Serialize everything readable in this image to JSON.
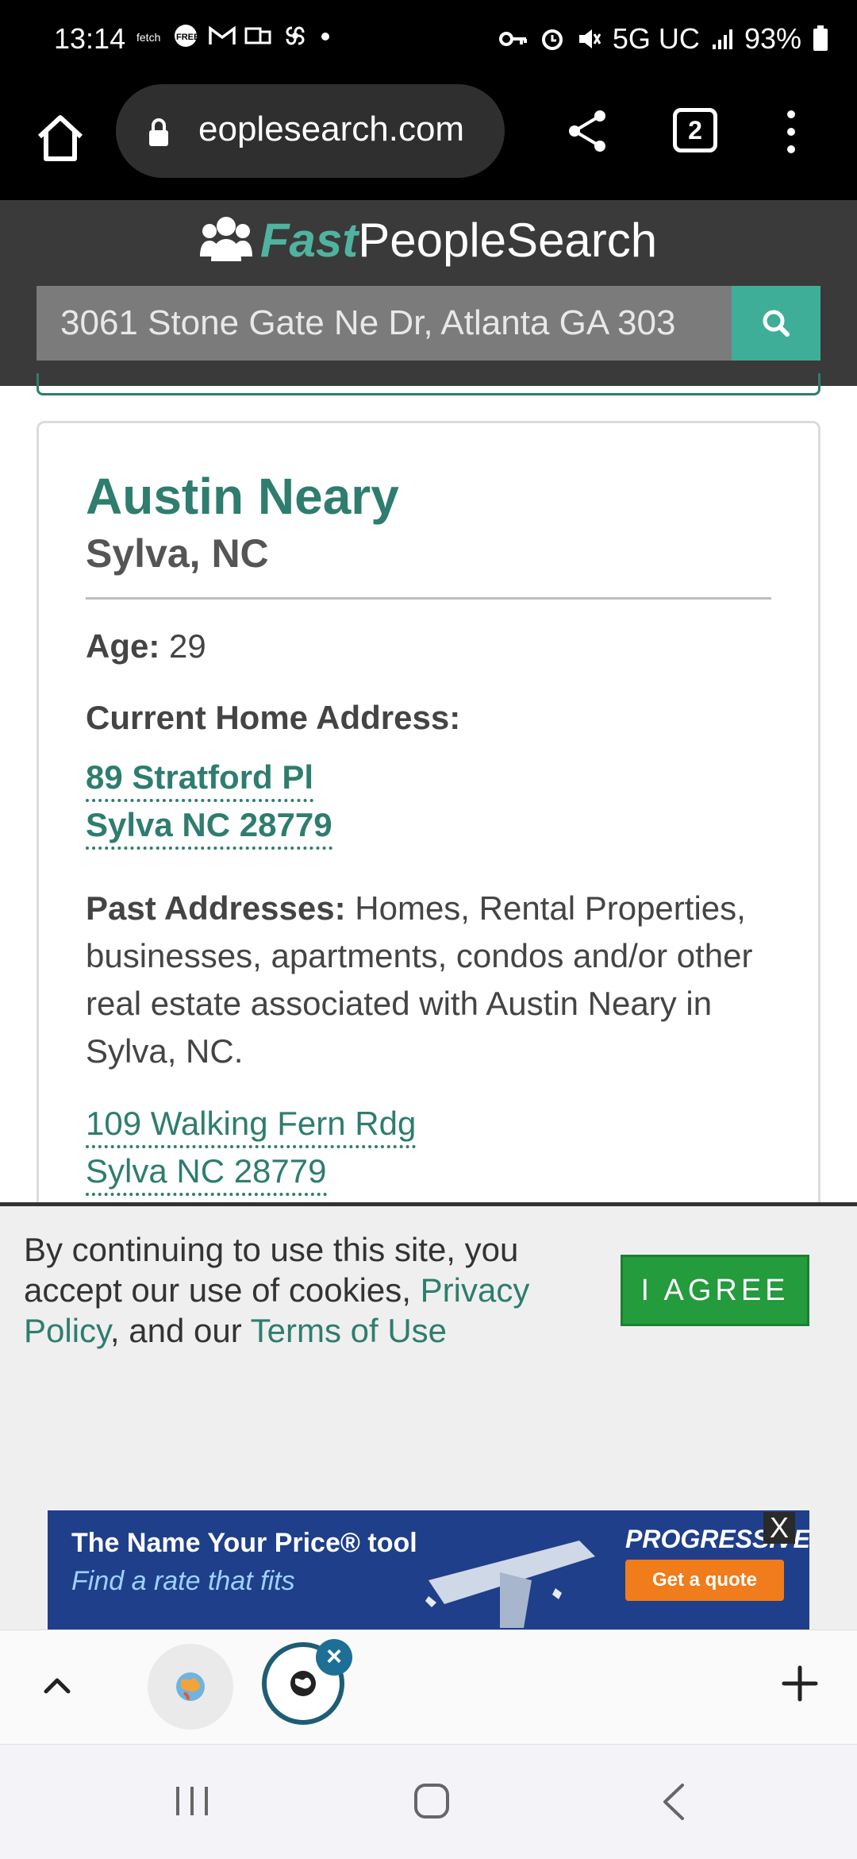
{
  "status_bar": {
    "time": "13:14",
    "network": "5G UC",
    "battery": "93%"
  },
  "browser": {
    "url": "eoplesearch.com",
    "tab_count": "2"
  },
  "site": {
    "logo_fast": "Fast",
    "logo_rest": "PeopleSearch",
    "search_value": "3061 Stone Gate Ne Dr, Atlanta GA 303"
  },
  "person": {
    "name": "Austin Neary",
    "location": "Sylva, NC",
    "age_label": "Age:",
    "age": "29",
    "current_label": "Current Home Address:",
    "current_address": [
      "89 Stratford Pl",
      "Sylva NC 28779"
    ],
    "past_label": "Past Addresses:",
    "past_text": "Homes, Rental Properties, businesses, apartments, condos and/or other real estate associated with Austin Neary in Sylva, NC.",
    "past_addresses": [
      "109 Walking Fern Rdg",
      "Sylva NC 28779"
    ]
  },
  "cookie": {
    "text_1": "By continuing to use this site, you accept our use of cookies, ",
    "privacy_link": "Privacy Policy",
    "text_2": ", and our ",
    "terms_link": "Terms of Use",
    "agree_label": "I AGREE"
  },
  "ad": {
    "title": "The Name Your Price® tool",
    "subtitle": "Find a rate that fits",
    "brand": "PROGRESSIVE",
    "cta": "Get a quote",
    "close": "X"
  },
  "colors": {
    "accent": "#2e7d6e",
    "search_button": "#3fae98",
    "agree_button": "#249b3c"
  }
}
